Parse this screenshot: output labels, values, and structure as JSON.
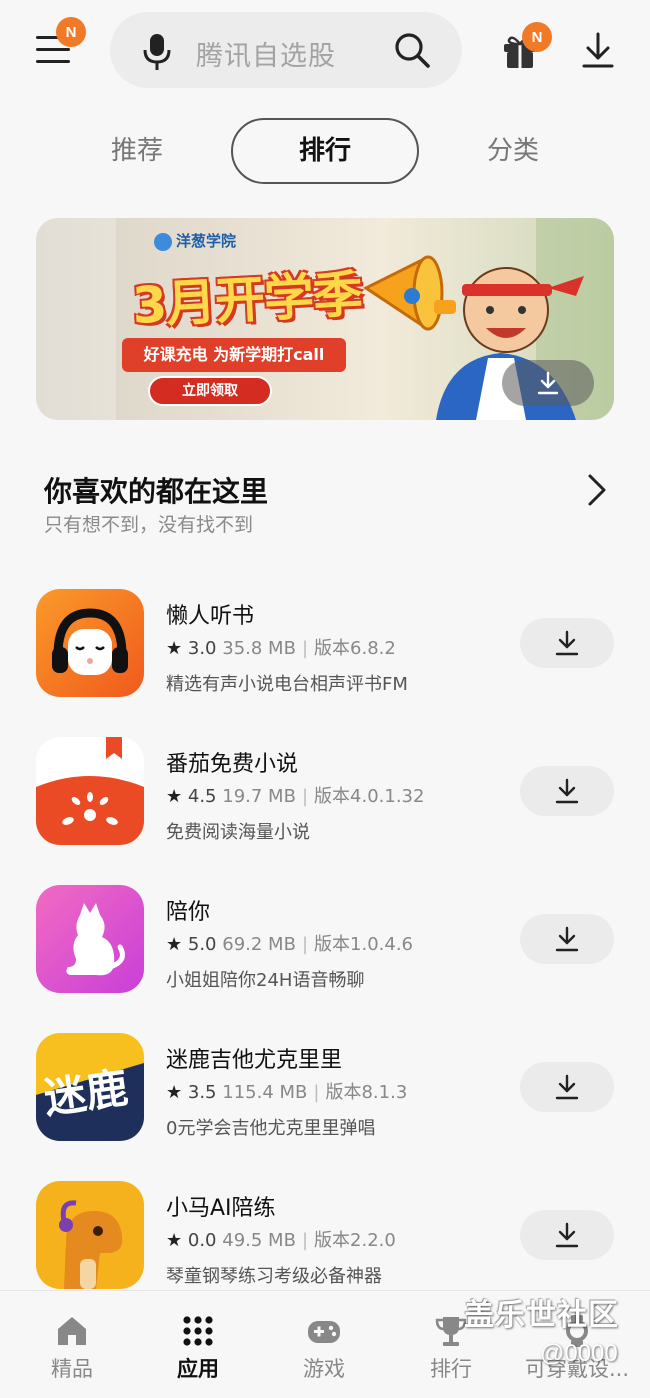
{
  "header": {
    "menu_badge": "N",
    "search_placeholder": "腾讯自选股",
    "gift_badge": "N"
  },
  "tabs": [
    {
      "label": "推荐",
      "active": false
    },
    {
      "label": "排行",
      "active": true
    },
    {
      "label": "分类",
      "active": false
    }
  ],
  "banner": {
    "brand": "洋葱学院",
    "headline": "3月开学季",
    "ribbon": "好课充电 为新学期打call",
    "cta": "立即领取"
  },
  "section": {
    "title": "你喜欢的都在这里",
    "subtitle": "只有想不到，没有找不到"
  },
  "apps": [
    {
      "name": "懒人听书",
      "rating": "3.0",
      "size": "35.8 MB",
      "version": "版本6.8.2",
      "desc": "精选有声小说电台相声评书FM",
      "icon": "headphones-icon"
    },
    {
      "name": "番茄免费小说",
      "rating": "4.5",
      "size": "19.7 MB",
      "version": "版本4.0.1.32",
      "desc": "免费阅读海量小说",
      "icon": "tomato-icon"
    },
    {
      "name": "陪你",
      "rating": "5.0",
      "size": "69.2 MB",
      "version": "版本1.0.4.6",
      "desc": "小姐姐陪你24H语音畅聊",
      "icon": "cat-icon"
    },
    {
      "name": "迷鹿吉他尤克里里",
      "rating": "3.5",
      "size": "115.4 MB",
      "version": "版本8.1.3",
      "desc": "0元学会吉他尤克里里弹唱",
      "icon": "milu-logo-icon"
    },
    {
      "name": "小马AI陪练",
      "rating": "0.0",
      "size": "49.5 MB",
      "version": "版本2.2.0",
      "desc": "琴童钢琴练习考级必备神器",
      "icon": "horse-icon"
    }
  ],
  "bottom_nav": [
    {
      "label": "精品",
      "icon": "home-icon",
      "active": false
    },
    {
      "label": "应用",
      "icon": "grid-icon",
      "active": true
    },
    {
      "label": "游戏",
      "icon": "gamepad-icon",
      "active": false
    },
    {
      "label": "排行",
      "icon": "trophy-icon",
      "active": false
    },
    {
      "label": "可穿戴设...",
      "icon": "watch-icon",
      "active": false
    }
  ],
  "watermark": {
    "text": "盖乐世社区",
    "sub": "@0000"
  },
  "colors": {
    "accent_badge": "#f07a28",
    "background": "#f7f7f7",
    "pill": "#ebebeb"
  }
}
